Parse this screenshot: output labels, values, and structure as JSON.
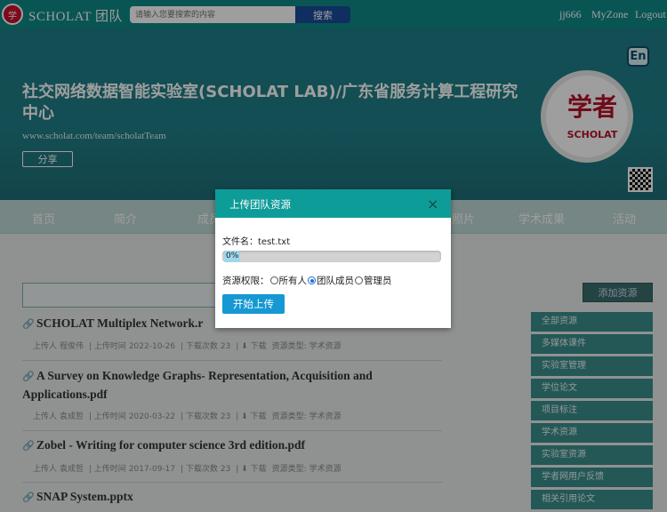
{
  "topbar": {
    "brand": "SCHOLAT 团队",
    "search_placeholder": "请输入您要搜索的内容",
    "search_button": "搜索",
    "user": "jj666",
    "myzone": "MyZone",
    "logout": "Logout"
  },
  "hero": {
    "title": "社交网络数据智能实验室(SCHOLAT LAB)/广东省服务计算工程研究中心",
    "url": "www.scholat.com/team/scholatTeam",
    "share_label": "分享",
    "lang_badge": "En",
    "seal_text": "SCHOLAT",
    "seal_chars": "学者"
  },
  "nav": {
    "items": [
      "首页",
      "简介",
      "成员",
      "",
      "",
      "",
      "照片",
      "学术成果",
      "活动"
    ]
  },
  "resources": {
    "add_label": "添加资源",
    "items": [
      {
        "title": "SCHOLAT Multiplex Network.r",
        "uploader_label": "上传人",
        "uploader": "程俊伟",
        "time_label": "上传时间",
        "time": "2022-10-26",
        "downloads_label": "下载次数",
        "downloads": "23",
        "download_label": "下载",
        "type_label": "资源类型:",
        "type": "学术资源"
      },
      {
        "title": "A Survey on Knowledge Graphs- Representation, Acquisition and Applications.pdf",
        "uploader_label": "上传人",
        "uploader": "袁成哲",
        "time_label": "上传时间",
        "time": "2020-03-22",
        "downloads_label": "下载次数",
        "downloads": "23",
        "download_label": "下载",
        "type_label": "资源类型:",
        "type": "学术资源"
      },
      {
        "title": "Zobel - Writing for computer science 3rd edition.pdf",
        "uploader_label": "上传人",
        "uploader": "袁成哲",
        "time_label": "上传时间",
        "time": "2017-09-17",
        "downloads_label": "下载次数",
        "downloads": "23",
        "download_label": "下载",
        "type_label": "资源类型:",
        "type": "学术资源"
      },
      {
        "title": "SNAP System.pptx"
      }
    ]
  },
  "side_menu": [
    "全部资源",
    "多媒体课件",
    "实验室管理",
    "学位论文",
    "项目标注",
    "学术资源",
    "实验室资源",
    "学者网用户反馈",
    "相关引用论文"
  ],
  "modal": {
    "title": "上传团队资源",
    "close": "×",
    "file_label": "文件名：test.txt",
    "progress_text": "0%",
    "progress": 0,
    "perm_label": "资源权限：",
    "options": [
      "所有人",
      "团队成员",
      "管理员"
    ],
    "selected_option": "团队成员",
    "start_button": "开始上传"
  }
}
